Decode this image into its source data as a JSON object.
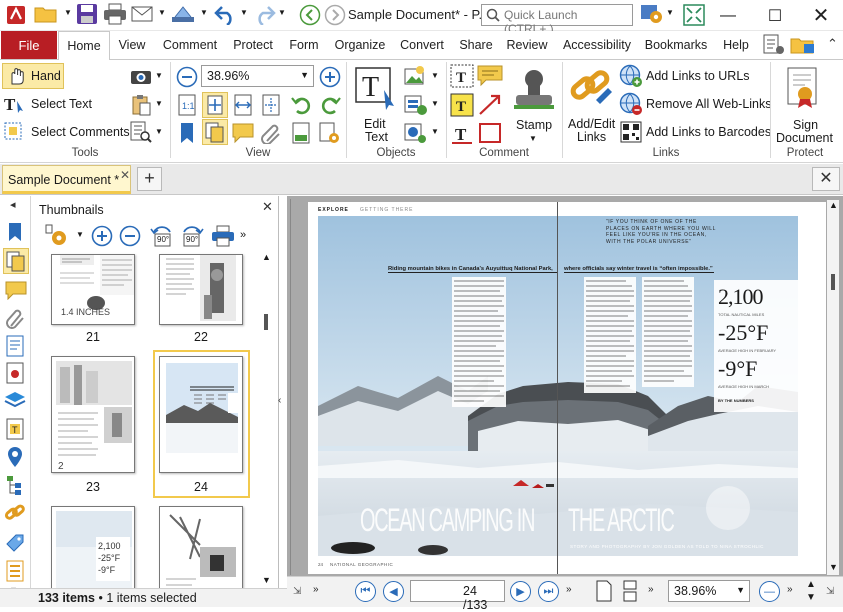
{
  "window": {
    "title": "Sample Document* - P...",
    "quick_launch_placeholder": "Quick Launch (CTRL+.)"
  },
  "ribbon_tabs": [
    "File",
    "Home",
    "View",
    "Comment",
    "Protect",
    "Form",
    "Organize",
    "Convert",
    "Share",
    "Review",
    "Accessibility",
    "Bookmarks",
    "Help"
  ],
  "active_tab": "Home",
  "ribbon": {
    "tools": {
      "hand": "Hand",
      "select_text": "Select Text",
      "select_comments": "Select Comments",
      "group": "Tools"
    },
    "view": {
      "zoom": "38.96%",
      "group": "View"
    },
    "objects": {
      "edit_text_line1": "Edit",
      "edit_text_line2": "Text",
      "group": "Objects"
    },
    "comment": {
      "stamp": "Stamp",
      "group": "Comment"
    },
    "links": {
      "add_edit_line1": "Add/Edit",
      "add_edit_line2": "Links",
      "add_links_urls": "Add Links to URLs",
      "remove_web_links": "Remove All Web-Links",
      "add_links_barcodes": "Add Links to Barcodes",
      "group": "Links"
    },
    "protect": {
      "sign_line1": "Sign",
      "sign_line2": "Document",
      "group": "Protect"
    }
  },
  "document_tab": "Sample Document *",
  "thumbnails": {
    "title": "Thumbnails",
    "rotate_left": "90°",
    "rotate_right": "90°",
    "pages": [
      {
        "num": "21"
      },
      {
        "num": "22"
      },
      {
        "num": "23"
      },
      {
        "num": "24"
      }
    ],
    "t21_caption": "1.4 INCHES"
  },
  "status": {
    "items": "133 items",
    "selected": "1 items selected"
  },
  "page_content": {
    "header_left": "EXPLORE",
    "header_sub": "GETTING THERE",
    "quote": "“IF YOU THINK OF ONE OF THE PLACES ON EARTH WHERE YOU WILL FEEL LIKE YOU'RE IN THE OCEAN, WITH THE POLAR UNIVERSE”",
    "left_lede": "Riding mountain bikes in Canada's Auyuittuq National Park,",
    "right_lede": "where officials say winter travel is “often impossible.”",
    "stat1": "2,100",
    "stat1_label": "TOTAL NAUTICAL MILES",
    "stat2": "-25°F",
    "stat2_label": "AVERAGE HIGH IN FEBRUARY",
    "stat3": "-9°F",
    "stat3_label": "AVERAGE HIGH IN MARCH",
    "stat_footer": "BY THE NUMBERS",
    "headline_left": "OCEAN CAMPING IN",
    "headline_right": "THE ARCTIC",
    "byline": "STORY AND PHOTOGRAPHY BY JON GOLDEN AS TOLD TO NINA STROCHLIC",
    "footer_left": "NATIONAL GEOGRAPHIC",
    "footer_page": "24"
  },
  "navigation": {
    "current_page": "24",
    "total_pages": "/133",
    "zoom": "38.96%"
  },
  "colors": {
    "file_tab": "#b81e24",
    "accent_blue": "#2a6bb8",
    "doc_tab": "#fff7cf",
    "active_thumb": "#f2c94c"
  }
}
